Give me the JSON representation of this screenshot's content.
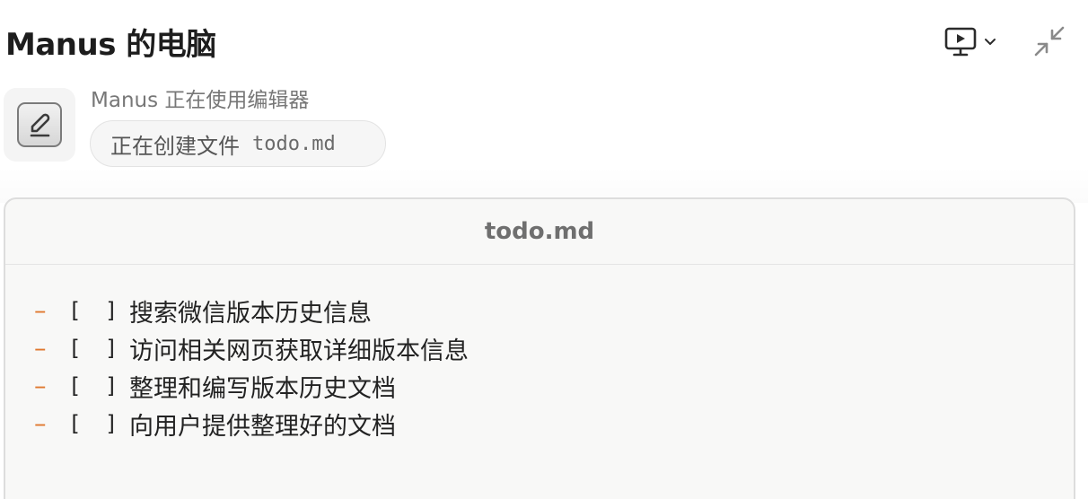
{
  "header": {
    "title": "Manus 的电脑",
    "view_switch_icon": "monitor-play-icon",
    "dropdown_icon": "chevron-down-icon",
    "minimize_icon": "minimize-arrows-icon"
  },
  "activity": {
    "tool_icon": "edit-pencil-icon",
    "status": "Manus 正在使用编辑器",
    "action_label": "正在创建文件",
    "action_file": "todo.md"
  },
  "editor": {
    "filename": "todo.md",
    "list_marker": "–",
    "checkbox": "[ ]",
    "items": [
      "搜索微信版本历史信息",
      "访问相关网页获取详细版本信息",
      "整理和编写版本历史文档",
      "向用户提供整理好的文档"
    ],
    "colors": {
      "marker": "#e0782f",
      "background": "#f8f8f7"
    }
  }
}
